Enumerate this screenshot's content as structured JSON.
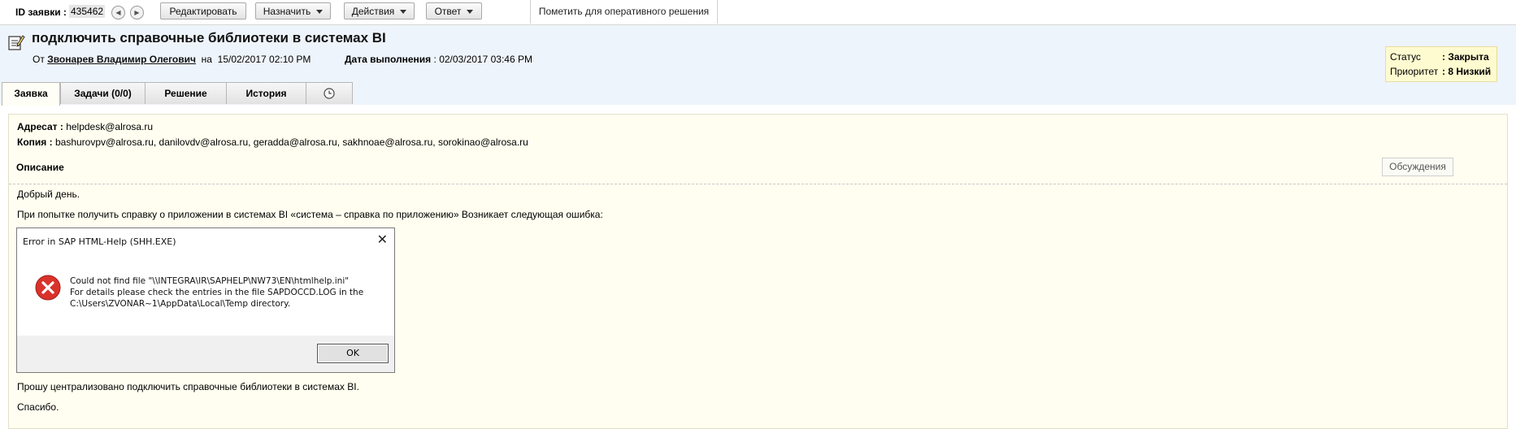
{
  "toolbar": {
    "id_label": "ID заявки :",
    "id_value": "435462",
    "prev_icon": "◀",
    "next_icon": "▶",
    "edit_label": "Редактировать",
    "assign_label": "Назначить",
    "actions_label": "Действия",
    "reply_label": "Ответ",
    "mark_label": "Пометить для оперативного решения"
  },
  "ticket": {
    "title": "подключить справочные библиотеки в системах BI",
    "from_label": "От",
    "author": "Звонарев Владимир Олегович",
    "on_label": "на",
    "created": "15/02/2017 02:10 PM",
    "due_label": "Дата выполнения",
    "due_value": ": 02/03/2017 03:46 PM",
    "status_label": "Статус",
    "status_value": ": Закрыта",
    "priority_label": "Приоритет",
    "priority_value": ": 8 Низкий"
  },
  "tabs": [
    {
      "label": "Заявка",
      "active": true
    },
    {
      "label": "Задачи (0/0)",
      "active": false
    },
    {
      "label": "Решение",
      "active": false
    },
    {
      "label": "История",
      "active": false
    },
    {
      "label": "",
      "icon": "clock-icon",
      "active": false
    }
  ],
  "content": {
    "to_label": "Адресат :",
    "to_value": "helpdesk@alrosa.ru",
    "cc_label": "Копия :",
    "cc_value": "bashurovpv@alrosa.ru, danilovdv@alrosa.ru, geradda@alrosa.ru, sakhnoae@alrosa.ru, sorokinao@alrosa.ru",
    "description_label": "Описание",
    "discussion_label": "Обсуждения",
    "line1": "Добрый день.",
    "line2": "При попытке получить справку о приложении в системах BI «система – справка по приложению» Возникает следующая ошибка:",
    "line3": "Прошу централизовано подключить справочные библиотеки в системах BI.",
    "line4": "Спасибо."
  },
  "dialog": {
    "title": "Error in SAP HTML-Help (SHH.EXE)",
    "close": "✕",
    "msg1": "Could not find file \"\\\\INTEGRA\\IR\\SAPHELP\\NW73\\EN\\htmlhelp.ini\"",
    "msg2": "For details please check the entries in the file SAPDOCCD.LOG in the",
    "msg3": "C:\\Users\\ZVONAR~1\\AppData\\Local\\Temp directory.",
    "ok_label": "OK"
  },
  "colors": {
    "header_bg": "#eef4fb",
    "content_bg": "#fffef0",
    "status_bg": "#fffbd0",
    "error_red": "#d9322b"
  }
}
